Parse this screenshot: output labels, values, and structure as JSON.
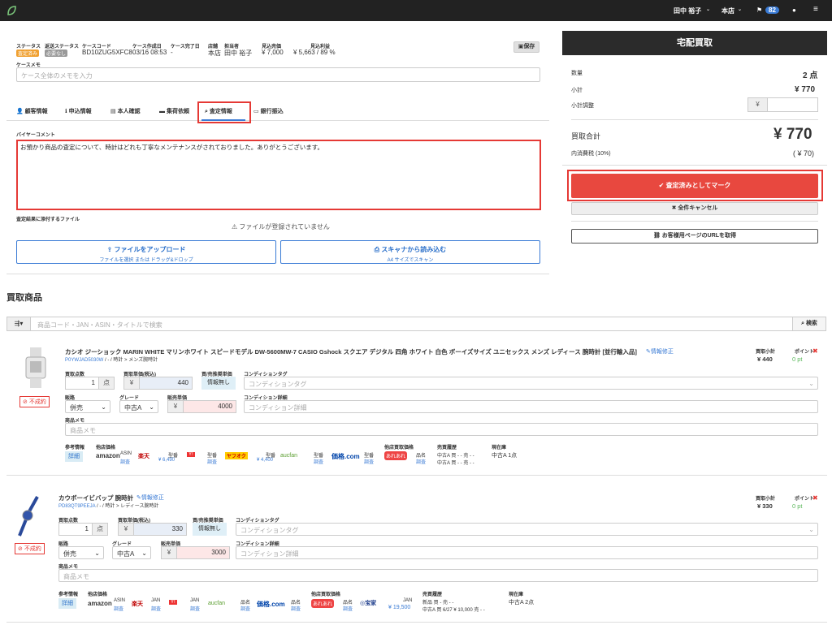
{
  "topbar": {
    "user": "田中 裕子",
    "store": "本店",
    "badge": "82"
  },
  "case": {
    "labels": {
      "status": "ステータス",
      "return_status": "返送ステータス",
      "case_code": "ケースコード",
      "created": "ケース作成日",
      "completed": "ケース完了日",
      "shop": "店舗",
      "staff": "担当者",
      "expected_sales": "見込売価",
      "expected_profit": "見込利益"
    },
    "status_tag": "査定済み",
    "return_tag": "必要なし",
    "case_code": "BD10ZUG5XFC8",
    "created": "03/16 08:53",
    "completed": "-",
    "shop": "本店",
    "staff": "田中 裕子",
    "expected_sales": "¥ 7,000",
    "expected_profit": "¥ 5,663 / 89 %",
    "save_button": "保存",
    "memo_label": "ケースメモ",
    "memo_placeholder": "ケース全体のメモを入力"
  },
  "tabs": [
    "顧客情報",
    "申込情報",
    "本人確認",
    "集荷依頼",
    "査定情報",
    "銀行振込"
  ],
  "assessment": {
    "buyer_comment_label": "バイヤーコメント",
    "buyer_comment": "お預かり商品の査定について、時計はどれも丁寧なメンテナンスがされておりました。ありがとうございます。",
    "file_label": "査定結果に添付するファイル",
    "no_file": "ファイルが登録されていません",
    "upload_title": "ファイルをアップロード",
    "upload_sub": "ファイルを選択 または ドラッグ&ドロップ",
    "scan_title": "スキャナから読み込む",
    "scan_sub": "A4 サイズでスキャン"
  },
  "summary": {
    "header": "宅配買取",
    "qty_label": "数量",
    "qty": "2 点",
    "subtotal_label": "小計",
    "subtotal": "¥ 770",
    "adjust_label": "小計調整",
    "adjust_prefix": "¥",
    "total_label": "買取合計",
    "total": "¥ 770",
    "tax_label": "内消費税 (10%)",
    "tax": "( ¥ 70)",
    "mark_button": "査定済みとしてマーク",
    "cancel_button": "全件キャンセル",
    "url_button": "お客様用ページのURLを取得"
  },
  "products": {
    "section_title": "買取商品",
    "search_placeholder": "商品コード・JAN・ASIN・タイトルで検索",
    "search_button": "検索",
    "labels": {
      "qty": "買取点数",
      "unit_price": "買取単価(税込)",
      "ref_price": "買/売推奨単価",
      "cond_tag": "コンディションタグ",
      "channel": "販路",
      "grade": "グレード",
      "sale_price": "販売単価",
      "cond_detail": "コンディション詳細",
      "memo": "商品メモ",
      "subtotal": "買取小計",
      "points": "ポイント",
      "ref_info": "参考情報",
      "other_price": "他店価格",
      "other_buy": "他店買取価格",
      "history": "売買履歴",
      "stock": "現在庫",
      "detail": "詳細",
      "unit": "点",
      "yen": "¥",
      "no_info": "情報無し",
      "edit": "情報修正",
      "cond_tag_ph": "コンディションタグ",
      "cond_detail_ph": "コンディション詳細",
      "memo_ph": "商品メモ",
      "ng": "不成約",
      "survey": "調査"
    },
    "items": [
      {
        "title": "カシオ ジーショック MARIN WHITE マリンホワイト スピードモデル DW-5600MW-7 CASIO Gshock スクエア デジタル 四角 ホワイト 白色 ボーイズサイズ ユニセックス メンズ レディース 腕時計 [並行輸入品]",
        "code": "P0YWJAD5030W",
        "path": "/ - / 時計 > メンズ腕時計",
        "qty": "1",
        "unit_price": "440",
        "channel": "併売",
        "grade": "中古A",
        "sale_price": "4000",
        "subtotal": "¥ 440",
        "points": "0 pt",
        "prices": {
          "amazon": "ASIN",
          "rakuten": "¥ 6,490",
          "yahoo": "型番",
          "yahooauc": "¥ 4,400",
          "aucfan": "型番",
          "kakaku": "型番",
          "other_buy": "品名"
        },
        "history": [
          "中古A 買 - - 売 - -",
          "中古A 買 - - 売 - -"
        ],
        "stock": "中古A 1点"
      },
      {
        "title": "カウボーイビバップ 腕時計",
        "code": "PD83QT9PEEJA",
        "path": "/ - / 時計 > レディース腕時計",
        "qty": "1",
        "unit_price": "330",
        "channel": "併売",
        "grade": "中古A",
        "sale_price": "3000",
        "subtotal": "¥ 330",
        "points": "0 pt",
        "prices": {
          "amazon": "ASIN",
          "rakuten": "JAN",
          "yahoo": "JAN",
          "aucfan": "品名",
          "kakaku": "品名",
          "other_buy": "品名",
          "other_buy2": "JAN",
          "other_buy2_price": "¥ 19,500"
        },
        "history": [
          "新品 買 - 売 - -",
          "中古A 買 6/27 ¥ 10,000 売 - -"
        ],
        "stock": "中古A 2点"
      }
    ]
  }
}
